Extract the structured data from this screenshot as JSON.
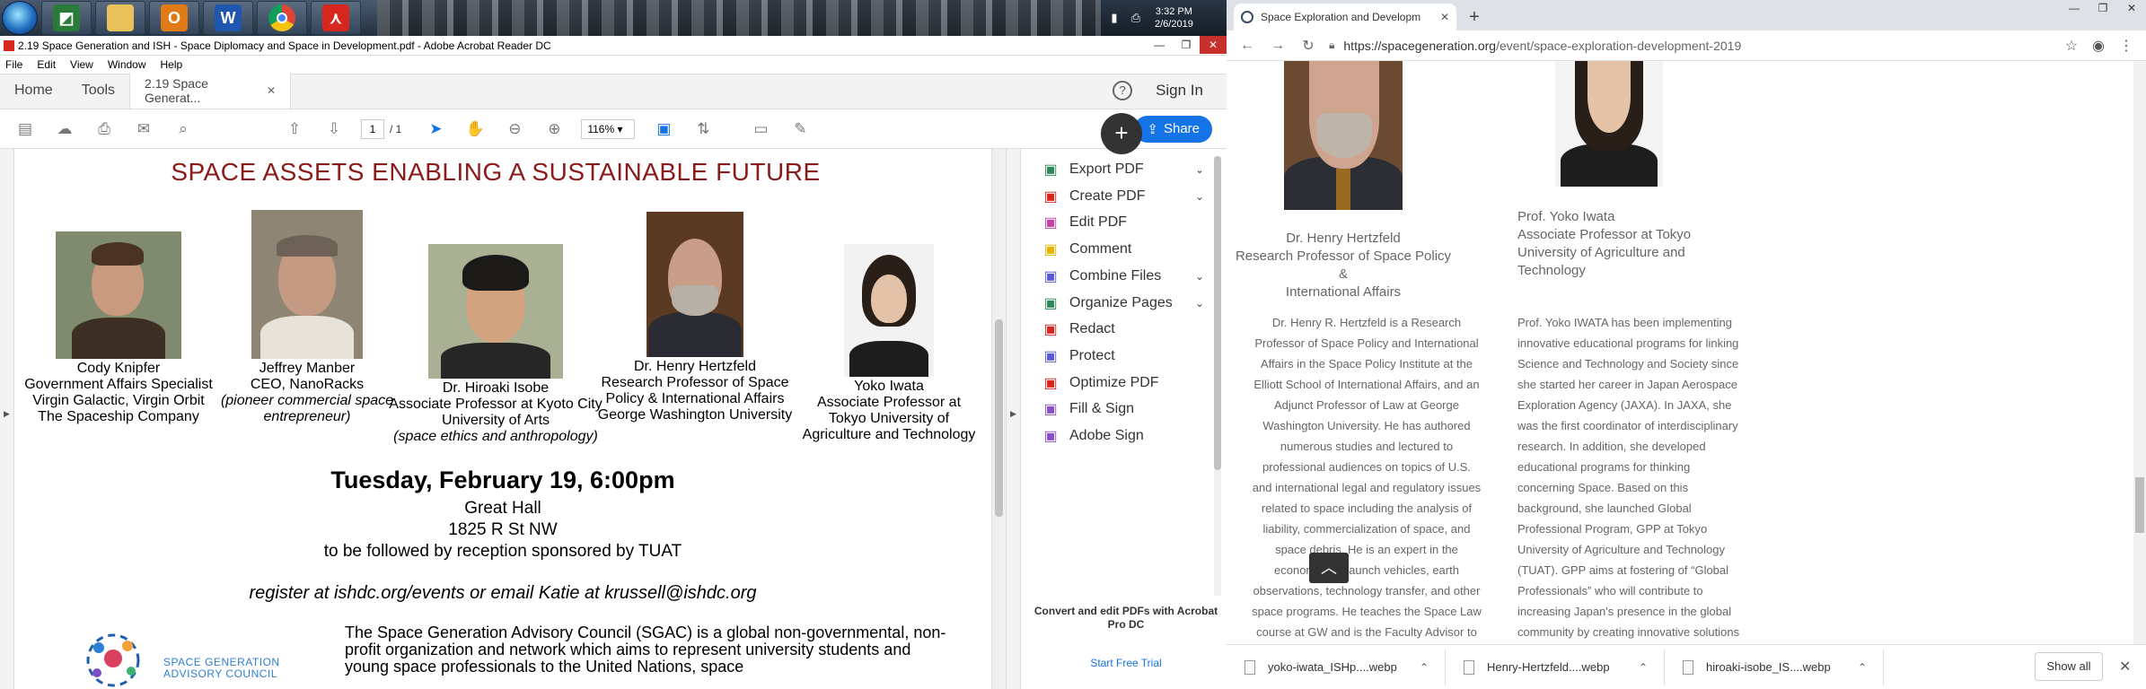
{
  "taskbar": {
    "apps": [
      "windows-start",
      "file-manager",
      "folder",
      "outlook",
      "word",
      "chrome",
      "acrobat"
    ],
    "clock_time": "3:32 PM",
    "clock_date": "2/6/2019"
  },
  "acrobat": {
    "window_title": "2.19 Space Generation and ISH - Space Diplomacy and Space in Development.pdf - Adobe Acrobat Reader DC",
    "menu": [
      "File",
      "Edit",
      "View",
      "Window",
      "Help"
    ],
    "tabs": {
      "home": "Home",
      "tools": "Tools",
      "doc": "2.19 Space Generat..."
    },
    "sign_in": "Sign In",
    "page_current": "1",
    "page_total": "/ 1",
    "zoom": "116%",
    "share": "Share",
    "tools": [
      {
        "label": "Export PDF",
        "chevron": true,
        "color": "#2d8a5a",
        "icon": "export-pdf-icon"
      },
      {
        "label": "Create PDF",
        "chevron": true,
        "color": "#d7261e",
        "icon": "create-pdf-icon"
      },
      {
        "label": "Edit PDF",
        "chevron": false,
        "color": "#c43fa6",
        "icon": "edit-pdf-icon"
      },
      {
        "label": "Comment",
        "chevron": false,
        "color": "#e5b500",
        "icon": "comment-icon"
      },
      {
        "label": "Combine Files",
        "chevron": true,
        "color": "#5a5ad6",
        "icon": "combine-files-icon"
      },
      {
        "label": "Organize Pages",
        "chevron": true,
        "color": "#2d8a5a",
        "icon": "organize-pages-icon"
      },
      {
        "label": "Redact",
        "chevron": false,
        "color": "#d7261e",
        "icon": "redact-icon"
      },
      {
        "label": "Protect",
        "chevron": false,
        "color": "#5a5ad6",
        "icon": "protect-icon"
      },
      {
        "label": "Optimize PDF",
        "chevron": false,
        "color": "#d7261e",
        "icon": "optimize-pdf-icon"
      },
      {
        "label": "Fill & Sign",
        "chevron": false,
        "color": "#8a4fc7",
        "icon": "fill-sign-icon"
      },
      {
        "label": "Adobe Sign",
        "chevron": false,
        "color": "#8a4fc7",
        "icon": "adobe-sign-icon"
      }
    ],
    "promo_text": "Convert and edit PDFs with Acrobat Pro DC",
    "promo_link": "Start Free Trial"
  },
  "pdf": {
    "heading": "SPACE ASSETS ENABLING A SUSTAINABLE FUTURE",
    "people": [
      {
        "lines": [
          "Cody Knipfer",
          "Government Affairs Specialist",
          "Virgin Galactic, Virgin Orbit",
          "The Spaceship Company"
        ],
        "italic": []
      },
      {
        "lines": [
          "Jeffrey Manber",
          "CEO, NanoRacks"
        ],
        "italic": [
          "(pioneer commercial space",
          "entrepreneur)"
        ]
      },
      {
        "lines": [
          "Dr. Hiroaki Isobe",
          "Associate Professor at Kyoto City",
          "University of Arts"
        ],
        "italic": [
          "(space ethics and anthropology)"
        ]
      },
      {
        "lines": [
          "Dr. Henry Hertzfeld",
          "Research Professor of Space",
          "Policy & International Affairs",
          "George Washington University"
        ],
        "italic": []
      },
      {
        "lines": [
          "Yoko Iwata",
          "Associate Professor at",
          "Tokyo University of",
          "Agriculture and Technology"
        ],
        "italic": []
      }
    ],
    "date": "Tuesday, February 19, 6:00pm",
    "venue": "Great Hall",
    "address": "1825 R St NW",
    "reception": "to be followed by reception sponsored by TUAT",
    "register": "register at ishdc.org/events or email Katie at krussell@ishdc.org",
    "logo_text": [
      "SPACE GENERATION",
      "ADVISORY COUNCIL"
    ],
    "sgac_paragraph": "The Space Generation Advisory Council (SGAC) is a global non-governmental, non-profit organization and network which aims to represent university students and young space professionals to the United Nations, space"
  },
  "chrome": {
    "tab_title": "Space Exploration and Developm",
    "url_domain": "https://spacegeneration.org",
    "url_path": "/event/space-exploration-development-2019",
    "henry_caption": [
      "Dr. Henry Hertzfeld",
      "Research Professor of Space Policy &",
      "International Affairs"
    ],
    "yoko_caption": [
      "Prof. Yoko Iwata",
      "Associate Professor at Tokyo",
      "University of Agriculture and",
      "Technology"
    ],
    "henry_bio": [
      "Dr. Henry R. Hertzfeld is a Research",
      "Professor of Space Policy and International",
      "Affairs in the Space Policy Institute at the",
      "Elliott School of International Affairs, and an",
      "Adjunct Professor of Law at George",
      "Washington University. He has authored",
      "numerous studies and lectured to",
      "professional audiences on topics of U.S.",
      "and international legal and regulatory issues",
      "related to space including the analysis of",
      "liability, commercialization of space, and",
      "space debris. He is an expert in the",
      "economics of launch vehicles, earth",
      "observations, technology transfer, and other",
      "space programs. He teaches the Space Law",
      "course at GW and is the Faculty Advisor to"
    ],
    "yoko_bio": [
      "Prof. Yoko IWATA has been implementing",
      "innovative educational programs for linking",
      "Science and Technology and Society since",
      "she started her career in Japan Aerospace",
      "Exploration Agency (JAXA). In JAXA, she",
      "was the first coordinator of interdisciplinary",
      "research. In addition, she developed",
      "educational programs for thinking",
      "concerning Space. Based on this",
      "background, she launched Global",
      "Professional Program, GPP at Tokyo",
      "University of Agriculture and Technology",
      "(TUAT). GPP aims at fostering of “Global",
      "Professionals” who will contribute to",
      "increasing Japan's presence in the global",
      "community by creating innovative solutions"
    ],
    "downloads": [
      "yoko-iwata_ISHp....webp",
      "Henry-Hertzfeld....webp",
      "hiroaki-isobe_IS....webp"
    ],
    "show_all": "Show all"
  }
}
